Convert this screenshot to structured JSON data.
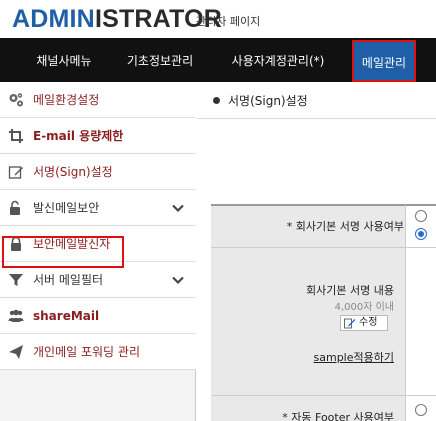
{
  "header": {
    "logo_part1": "ADMIN",
    "logo_part2": "ISTRATOR",
    "subtitle": "관리자 페이지"
  },
  "topnav": {
    "tabs": [
      {
        "label": "채널사메뉴"
      },
      {
        "label": "기초정보관리"
      },
      {
        "label": "사용자계정관리(*)"
      },
      {
        "label": "메일관리"
      }
    ],
    "active_tab": "메일관리"
  },
  "sidebar": {
    "items": [
      {
        "label": "메일환경설정",
        "icon": "gears-icon"
      },
      {
        "label": "E-mail 용량제한",
        "icon": "crop-icon"
      },
      {
        "label": "서명(Sign)설정",
        "icon": "edit-icon"
      },
      {
        "label": "발신메일보안",
        "icon": "unlock-icon"
      },
      {
        "label": "보안메일발신자",
        "icon": "lock-icon"
      },
      {
        "label": "서버 메일필터",
        "icon": "filter-icon"
      },
      {
        "label": "shareMail",
        "icon": "users-icon"
      },
      {
        "label": "개인메일 포워딩 관리",
        "icon": "send-icon"
      }
    ],
    "selected": "서명(Sign)설정"
  },
  "main": {
    "section_title": "서명(Sign)설정",
    "form": {
      "row1_label": "* 회사기본 서명 사용여부",
      "row2_label": "회사기본 서명 내용",
      "row2_hint": "4,000자 이내",
      "edit_button": "수정",
      "sample_link": "sample적용하기",
      "row3_label": "* 자동 Footer 사용여부"
    }
  },
  "colors": {
    "brand_blue": "#1f5fa7",
    "nav_bg": "#111111",
    "active_tab_bg": "#1e5fa8",
    "highlight_red": "#dd1111",
    "sidebar_label_red": "#8a1e1e"
  }
}
